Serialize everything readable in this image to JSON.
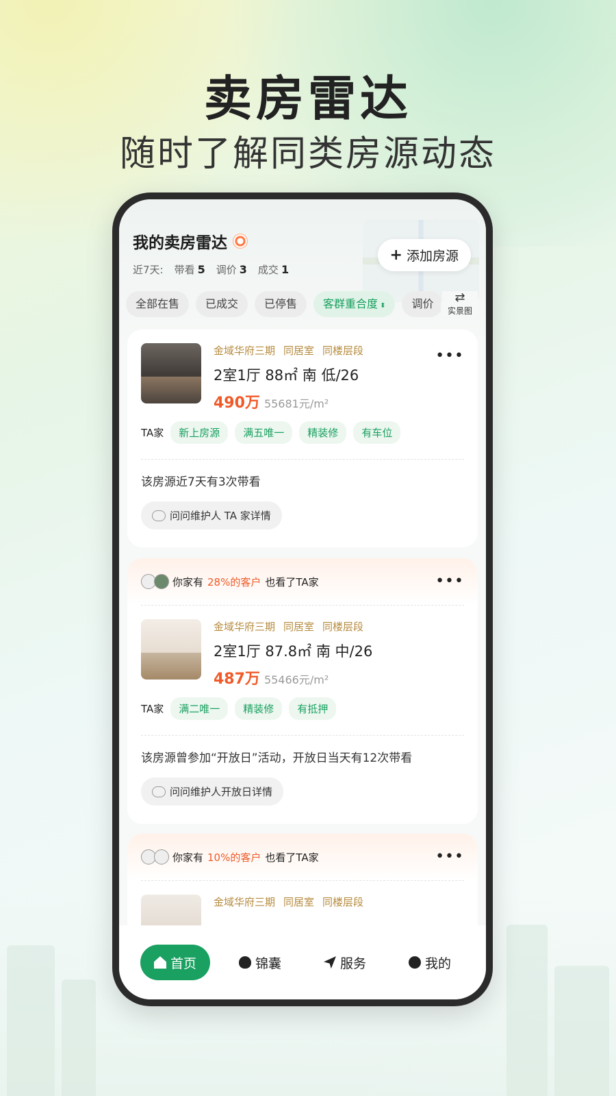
{
  "hero": {
    "title": "卖房雷达",
    "subtitle": "随时了解同类房源动态"
  },
  "header": {
    "title": "我的卖房雷达",
    "stats_prefix": "近7天:",
    "stats": [
      {
        "label": "带看",
        "value": "5"
      },
      {
        "label": "调价",
        "value": "3"
      },
      {
        "label": "成交",
        "value": "1"
      }
    ],
    "add_button": "添加房源"
  },
  "tabs": [
    "全部在售",
    "已成交",
    "已停售",
    "客群重合度",
    "调价"
  ],
  "active_tab": "客群重合度",
  "scene_button": "实景图",
  "cards": [
    {
      "community": "金域华府三期",
      "tag1": "同居室",
      "tag2": "同楼层段",
      "spec": "2室1厅 88㎡ 南 低/26",
      "price": "490万",
      "unit_price": "55681元/m²",
      "owner": "TA家",
      "labels": [
        "新上房源",
        "满五唯一",
        "精装修",
        "有车位"
      ],
      "note": "该房源近7天有3次带看",
      "ask": "问问维护人 TA 家详情"
    },
    {
      "head_prefix": "你家有",
      "head_pct": "28%的客户",
      "head_suffix": "也看了TA家",
      "community": "金域华府三期",
      "tag1": "同居室",
      "tag2": "同楼层段",
      "spec": "2室1厅 87.8㎡ 南 中/26",
      "price": "487万",
      "unit_price": "55466元/m²",
      "owner": "TA家",
      "labels": [
        "满二唯一",
        "精装修",
        "有抵押"
      ],
      "note": "该房源曾参加“开放日”活动，开放日当天有12次带看",
      "ask": "问问维护人开放日详情"
    },
    {
      "head_prefix": "你家有",
      "head_pct": "10%的客户",
      "head_suffix": "也看了TA家",
      "community": "金域华府三期",
      "tag1": "同居室",
      "tag2": "同楼层段"
    }
  ],
  "tabbar": [
    {
      "label": "首页",
      "icon": "home-icon",
      "active": true
    },
    {
      "label": "锦囊",
      "icon": "money-bag-icon"
    },
    {
      "label": "服务",
      "icon": "send-icon"
    },
    {
      "label": "我的",
      "icon": "profile-icon"
    }
  ],
  "colors": {
    "accent": "#1aa060",
    "price": "#f05a28",
    "tag": "#b58a3d"
  }
}
